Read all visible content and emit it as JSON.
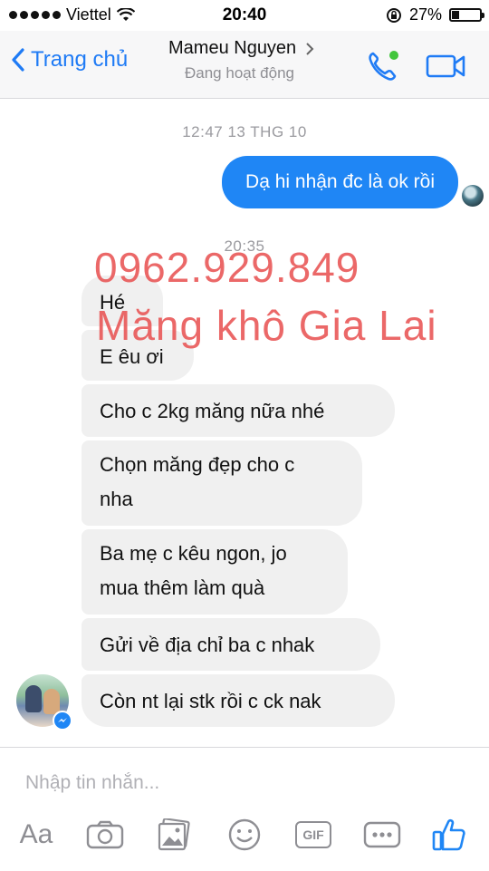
{
  "status_bar": {
    "carrier": "Viettel",
    "time": "20:40",
    "battery": "27%",
    "battery_level": 0.27
  },
  "header": {
    "back_label": "Trang chủ",
    "contact_name": "Mameu Nguyen",
    "contact_status": "Đang hoạt động",
    "icons": [
      "back-chevron-icon",
      "chevron-right-icon",
      "phone-call-icon",
      "video-call-icon"
    ]
  },
  "chat": {
    "timestamp_1": "12:47 13 THG 10",
    "outgoing": [
      {
        "text": "Dạ hi nhận đc là ok rồi"
      }
    ],
    "timestamp_2": "20:35",
    "incoming": [
      {
        "text": "Hé"
      },
      {
        "text": "E êu ơi"
      },
      {
        "text": "Cho c 2kg măng nữa nhé"
      },
      {
        "line1": "Chọn măng đẹp cho c",
        "line2": "nha"
      },
      {
        "line1": "Ba mẹ c kêu ngon, jo",
        "line2": "mua thêm làm quà"
      },
      {
        "text": "Gửi về địa chỉ ba c nhak"
      },
      {
        "text": "Còn nt lại stk rồi c ck nak"
      }
    ],
    "watermark": {
      "phone": "0962.929.849",
      "brand": "Măng khô Gia Lai"
    }
  },
  "composer": {
    "placeholder": "Nhập tin nhắn...",
    "aa_label": "Aa",
    "gif_label": "GIF",
    "icons": [
      "camera-icon",
      "gallery-icon",
      "emoji-icon",
      "gif-icon",
      "more-icon",
      "like-icon"
    ]
  },
  "colors": {
    "accent": "#1f86f5",
    "watermark": "#e84e4e",
    "incoming_bubble": "#f0f0f0"
  }
}
